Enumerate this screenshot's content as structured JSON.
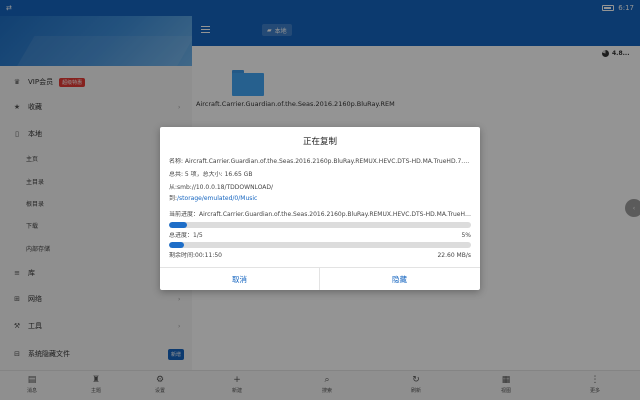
{
  "status_bar": {
    "time": "6:17",
    "left_icon": "screen-mirror-icon"
  },
  "sidebar": {
    "vip": {
      "label": "VIP会员",
      "badge": "超级特惠"
    },
    "items": [
      {
        "label": "收藏",
        "icon": "star-icon"
      },
      {
        "label": "本地",
        "icon": "phone-icon"
      },
      {
        "label": "库",
        "icon": "database-icon"
      },
      {
        "label": "网络",
        "icon": "network-icon"
      },
      {
        "label": "工具",
        "icon": "wrench-icon"
      },
      {
        "label": "系统隐藏文件",
        "icon": "toggle-icon",
        "badge": "新增"
      }
    ],
    "local_sub": [
      "主页",
      "主目录",
      "根目录",
      "下载",
      "内部存储"
    ]
  },
  "topbar": {
    "location": "本地"
  },
  "storage": {
    "value": "4.8..."
  },
  "folder": {
    "name": "Aircraft.Carrier.Guardian.of.the.Seas.2016.2160p.BluRay.REM"
  },
  "bottom_bar": {
    "items": [
      {
        "label": "消息",
        "icon": "message-icon"
      },
      {
        "label": "主题",
        "icon": "tshirt-icon"
      },
      {
        "label": "设置",
        "icon": "gear-icon"
      },
      {
        "label": "新建",
        "icon": "plus-icon"
      },
      {
        "label": "搜索",
        "icon": "search-icon"
      },
      {
        "label": "刷新",
        "icon": "refresh-icon"
      },
      {
        "label": "视图",
        "icon": "grid-icon"
      },
      {
        "label": "更多",
        "icon": "more-icon"
      }
    ]
  },
  "dialog": {
    "title": "正在复制",
    "name_line": "名称: Aircraft.Carrier.Guardian.of.the.Seas.2016.2160p.BluRay.REMUX.HEVC.DTS-HD.MA.TrueHD.7.1.At...",
    "totals_line": "总共: 5 项，总大小: 16.65 GB",
    "from_line": "从:smb://10.0.0.18/TDDOWNLOAD/",
    "to_label": "到:",
    "to_path": "/storage/emulated/0/Music",
    "current_line": "当前进度：Aircraft.Carrier.Guardian.of.the.Seas.2016.2160p.BluRay.REMUX.HEVC.DTS-HD.MA.TrueHD.7.1.Atmos-FG...",
    "current_progress_percent": 6,
    "total_label": "总进度：1/5",
    "total_percent": "5%",
    "total_progress_percent": 5,
    "remaining": "剩余时间:00:11:50",
    "speed": "22.60 MB/s",
    "cancel_label": "取消",
    "hide_label": "隐藏"
  },
  "colors": {
    "accent": "#1565c0",
    "progress_fill": "#1e6ec8",
    "vip_badge": "#e53935"
  }
}
